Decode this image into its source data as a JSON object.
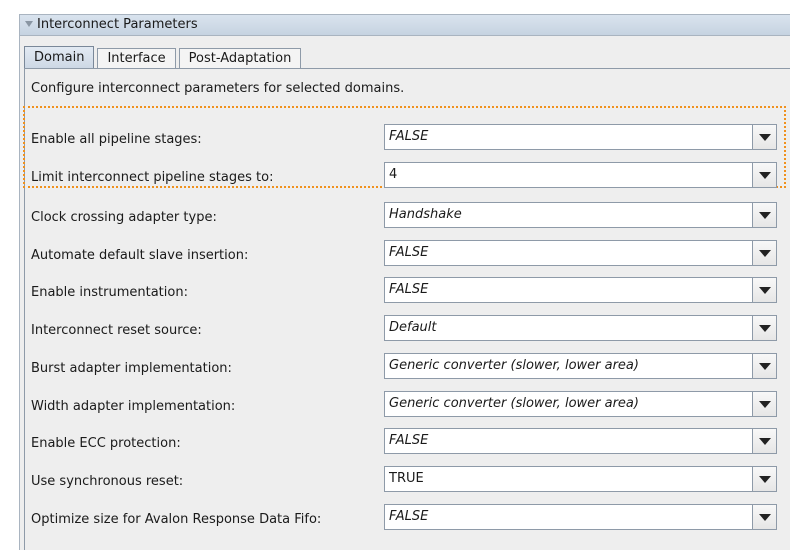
{
  "panel": {
    "title": "Interconnect Parameters",
    "collapse_icon": "triangle-down-icon"
  },
  "tabs": [
    {
      "label": "Domain",
      "active": true
    },
    {
      "label": "Interface",
      "active": false
    },
    {
      "label": "Post-Adaptation",
      "active": false
    }
  ],
  "description": "Configure interconnect parameters for selected domains.",
  "highlight_color": "#f0911d",
  "params": [
    {
      "label": "Enable all pipeline stages:",
      "value": "FALSE",
      "italic": true
    },
    {
      "label": "Limit interconnect pipeline stages to:",
      "value": "4",
      "italic": false
    },
    {
      "label": "Clock crossing adapter type:",
      "value": "Handshake",
      "italic": true
    },
    {
      "label": "Automate default slave insertion:",
      "value": "FALSE",
      "italic": true
    },
    {
      "label": "Enable instrumentation:",
      "value": "FALSE",
      "italic": true
    },
    {
      "label": "Interconnect reset source:",
      "value": "Default",
      "italic": true
    },
    {
      "label": "Burst adapter implementation:",
      "value": "Generic converter (slower, lower area)",
      "italic": true
    },
    {
      "label": "Width adapter implementation:",
      "value": "Generic converter (slower, lower area)",
      "italic": true
    },
    {
      "label": "Enable ECC protection:",
      "value": "FALSE",
      "italic": true
    },
    {
      "label": "Use synchronous reset:",
      "value": "TRUE",
      "italic": false
    },
    {
      "label": "Optimize size for Avalon Response Data Fifo:",
      "value": "FALSE",
      "italic": true
    }
  ]
}
